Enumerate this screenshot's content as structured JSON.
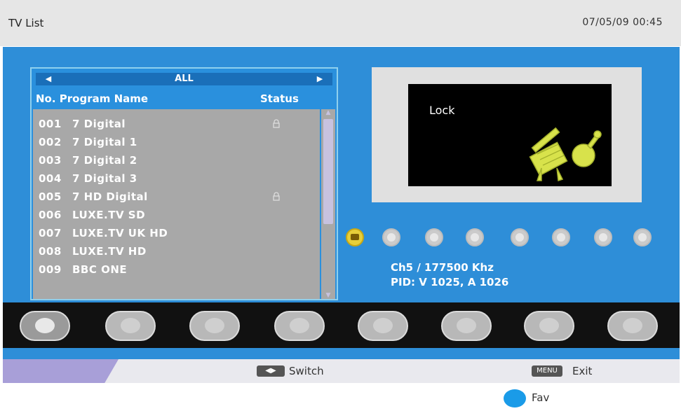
{
  "header": {
    "title": "TV List",
    "datetime": "07/05/09  00:45"
  },
  "list": {
    "group": "ALL",
    "columns": {
      "program": "No. Program Name",
      "status": "Status"
    },
    "rows": [
      {
        "no": "001",
        "name": "7  Digital",
        "locked": true
      },
      {
        "no": "002",
        "name": "7  Digital  1",
        "locked": false
      },
      {
        "no": "003",
        "name": "7  Digital   2",
        "locked": false
      },
      {
        "no": "004",
        "name": "7  Digital   3",
        "locked": false
      },
      {
        "no": "005",
        "name": "7  HD  Digital",
        "locked": true
      },
      {
        "no": "006",
        "name": "LUXE.TV SD",
        "locked": false
      },
      {
        "no": "007",
        "name": "LUXE.TV UK  HD",
        "locked": false
      },
      {
        "no": "008",
        "name": "LUXE.TV HD",
        "locked": false
      },
      {
        "no": "009",
        "name": "BBC  ONE",
        "locked": false
      }
    ]
  },
  "preview": {
    "label": "Lock"
  },
  "info": {
    "channel": "Ch5 / 177500  Khz",
    "pid": "PID: V 1025, A 1026"
  },
  "footer": {
    "switch_key": "◀▶",
    "switch_label": "Switch",
    "menu_key": "MENU",
    "exit_label": "Exit",
    "fav_label": "Fav"
  },
  "colors": {
    "accent_blue": "#2e8ed8",
    "fav": "#1a9be8",
    "selected_icon": "#e7cf3a"
  }
}
